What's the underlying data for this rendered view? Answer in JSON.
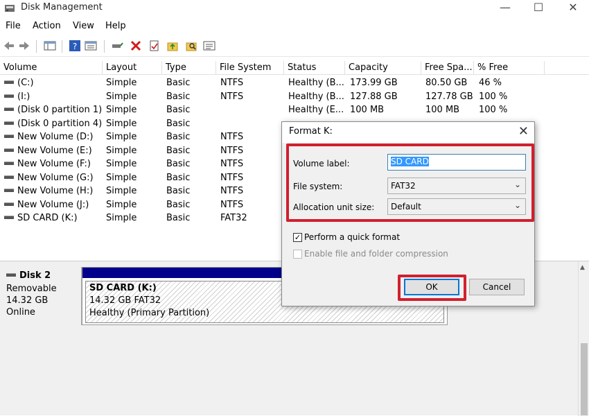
{
  "window": {
    "title": "Disk Management",
    "minimize": "—",
    "maximize": "☐",
    "close": "✕"
  },
  "menu": [
    "File",
    "Action",
    "View",
    "Help"
  ],
  "table": {
    "columns": [
      "Volume",
      "Layout",
      "Type",
      "File System",
      "Status",
      "Capacity",
      "Free Spa...",
      "% Free"
    ],
    "rows": [
      {
        "volume": "(C:)",
        "layout": "Simple",
        "type": "Basic",
        "fs": "NTFS",
        "status": "Healthy (B...",
        "capacity": "173.99 GB",
        "free": "80.50 GB",
        "pct": "46 %"
      },
      {
        "volume": "(I:)",
        "layout": "Simple",
        "type": "Basic",
        "fs": "NTFS",
        "status": "Healthy (B...",
        "capacity": "127.88 GB",
        "free": "127.78 GB",
        "pct": "100 %"
      },
      {
        "volume": "(Disk 0 partition 1)",
        "layout": "Simple",
        "type": "Basic",
        "fs": "",
        "status": "Healthy (E...",
        "capacity": "100 MB",
        "free": "100 MB",
        "pct": "100 %"
      },
      {
        "volume": "(Disk 0 partition 4)",
        "layout": "Simple",
        "type": "Basic",
        "fs": "",
        "status": "",
        "capacity": "",
        "free": "",
        "pct": ""
      },
      {
        "volume": "New Volume (D:)",
        "layout": "Simple",
        "type": "Basic",
        "fs": "NTFS",
        "status": "",
        "capacity": "",
        "free": "",
        "pct": ""
      },
      {
        "volume": "New Volume (E:)",
        "layout": "Simple",
        "type": "Basic",
        "fs": "NTFS",
        "status": "",
        "capacity": "",
        "free": "",
        "pct": ""
      },
      {
        "volume": "New Volume (F:)",
        "layout": "Simple",
        "type": "Basic",
        "fs": "NTFS",
        "status": "",
        "capacity": "",
        "free": "",
        "pct": ""
      },
      {
        "volume": "New Volume (G:)",
        "layout": "Simple",
        "type": "Basic",
        "fs": "NTFS",
        "status": "",
        "capacity": "",
        "free": "",
        "pct": ""
      },
      {
        "volume": "New Volume (H:)",
        "layout": "Simple",
        "type": "Basic",
        "fs": "NTFS",
        "status": "",
        "capacity": "",
        "free": "",
        "pct": ""
      },
      {
        "volume": "New Volume (J:)",
        "layout": "Simple",
        "type": "Basic",
        "fs": "NTFS",
        "status": "",
        "capacity": "",
        "free": "",
        "pct": ""
      },
      {
        "volume": "SD CARD (K:)",
        "layout": "Simple",
        "type": "Basic",
        "fs": "FAT32",
        "status": "",
        "capacity": "",
        "free": "",
        "pct": ""
      }
    ]
  },
  "disk": {
    "name": "Disk 2",
    "kind": "Removable",
    "size": "14.32 GB",
    "state": "Online",
    "partition": {
      "title": "SD CARD  (K:)",
      "detail": "14.32 GB FAT32",
      "status": "Healthy (Primary Partition)"
    }
  },
  "dialog": {
    "title": "Format K:",
    "close": "✕",
    "volume_label_label": "Volume label:",
    "volume_label_value": "SD CARD",
    "file_system_label": "File system:",
    "file_system_value": "FAT32",
    "alloc_label": "Allocation unit size:",
    "alloc_value": "Default",
    "quick_format_label": "Perform a quick format",
    "quick_format_checked": true,
    "compression_label": "Enable file and folder compression",
    "compression_checked": false,
    "ok": "OK",
    "cancel": "Cancel"
  },
  "colors": {
    "highlight": "#d0202e",
    "partition_bar": "#00008b",
    "selection": "#3399ff"
  }
}
